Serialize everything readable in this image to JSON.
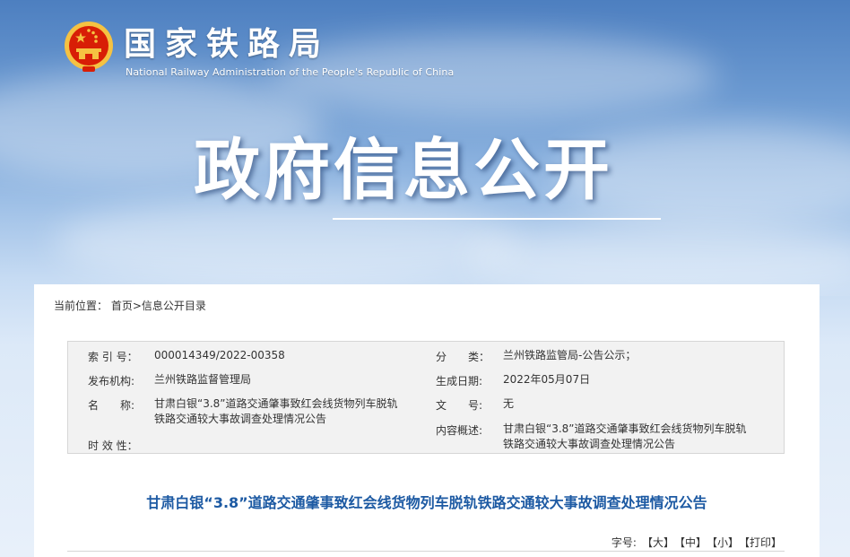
{
  "header": {
    "agency_cn": "国家铁路局",
    "agency_en": "National Railway Administration of the People's Republic of China",
    "banner_title": "政府信息公开"
  },
  "breadcrumb": {
    "prefix": "当前位置：",
    "home": "首页",
    "separator": ">",
    "current": "信息公开目录"
  },
  "meta": {
    "index_label": "索 引 号：",
    "index_value": "000014349/2022-00358",
    "category_label": "分　　类：",
    "category_value": "兰州铁路监管局-公告公示；",
    "issuer_label": "发布机构:",
    "issuer_value": "兰州铁路监督管理局",
    "date_label": "生成日期:",
    "date_value": "2022年05月07日",
    "name_label": "名　　称:",
    "name_value_line1": "甘肃白银“3.8”道路交通肇事致红会线货物列车脱轨",
    "name_value_line2": "铁路交通较大事故调查处理情况公告",
    "docno_label": "文　　号:",
    "docno_value": "无",
    "summary_label": "内容概述:",
    "summary_value_line1": "甘肃白银“3.8”道路交通肇事致红会线货物列车脱轨",
    "summary_value_line2": "铁路交通较大事故调查处理情况公告",
    "validity_label": "时 效 性："
  },
  "article": {
    "title": "甘肃白银“3.8”道路交通肇事致红会线货物列车脱轨铁路交通较大事故调查处理情况公告"
  },
  "font_size": {
    "label": "字号:",
    "large": "【大】",
    "medium": "【中】",
    "small": "【小】",
    "print": "【打印】"
  },
  "colors": {
    "title_blue": "#1d5aa3",
    "emblem_red": "#d81e06",
    "emblem_gold": "#f5c242"
  }
}
